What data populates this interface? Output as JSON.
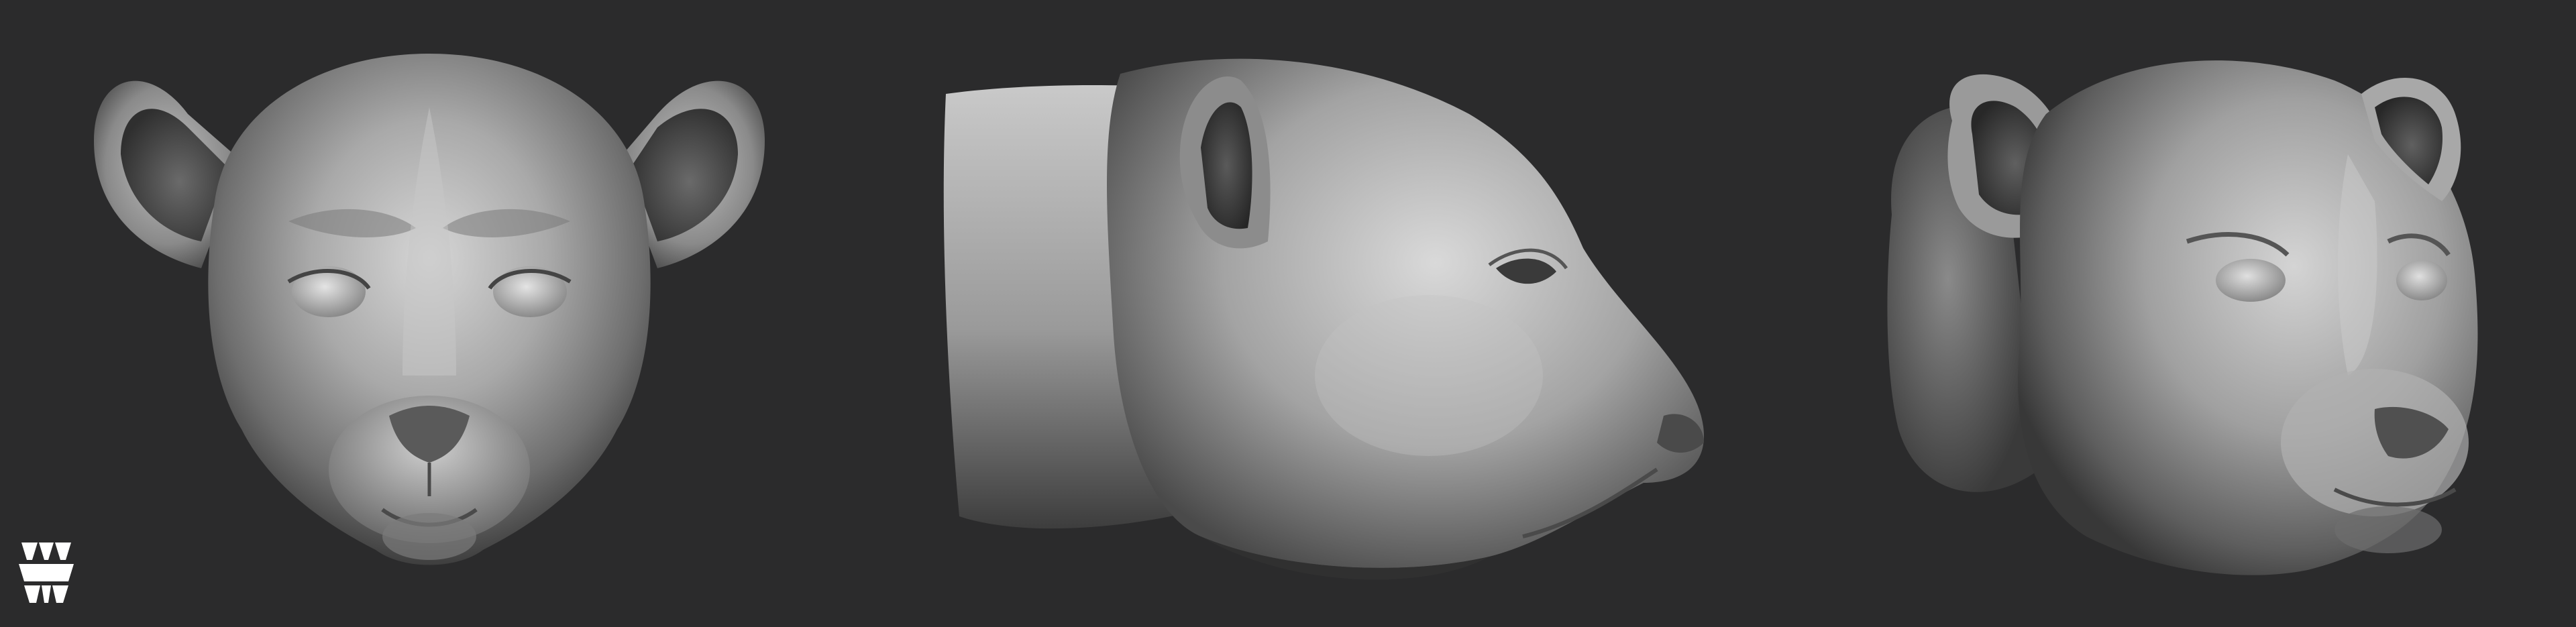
{
  "scene": {
    "background_color": "#2b2b2c",
    "clay_color": "#8f8f8f",
    "views": [
      {
        "id": "front",
        "icon": "cougar-head-front-view"
      },
      {
        "id": "side",
        "icon": "cougar-head-side-profile"
      },
      {
        "id": "three-quarter",
        "icon": "cougar-head-three-quarter-view"
      }
    ],
    "logo": {
      "icon": "studio-logo-mark",
      "color": "#ffffff"
    }
  }
}
